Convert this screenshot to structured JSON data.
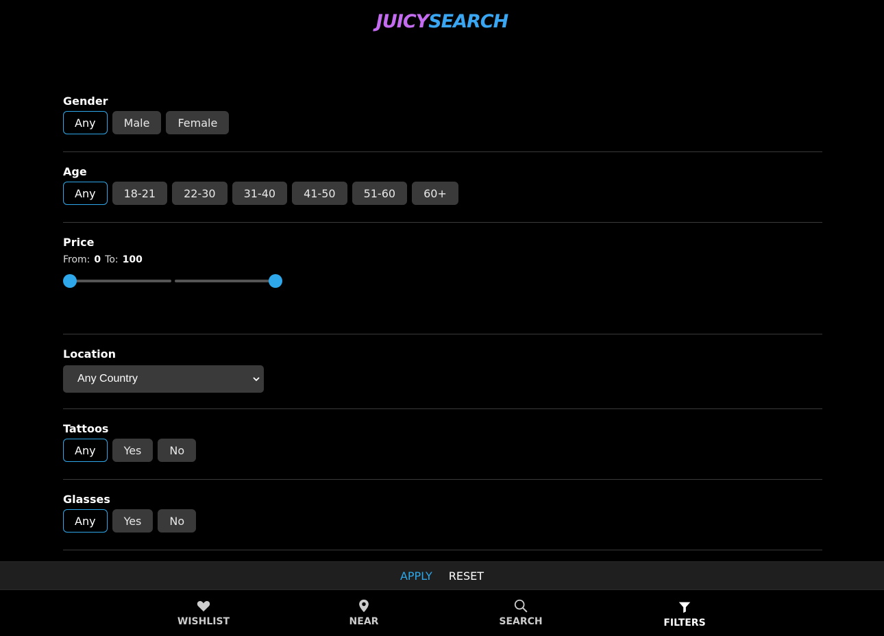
{
  "header": {
    "logo_part1": "JUICY",
    "logo_part2": "SEARCH"
  },
  "filters": {
    "gender": {
      "title": "Gender",
      "options": [
        "Any",
        "Male",
        "Female"
      ],
      "selected": "Any"
    },
    "age": {
      "title": "Age",
      "options": [
        "Any",
        "18-21",
        "22-30",
        "31-40",
        "41-50",
        "51-60",
        "60+"
      ],
      "selected": "Any"
    },
    "price": {
      "title": "Price",
      "from_label": "From:",
      "from_value": "0",
      "to_label": "To:",
      "to_value": "100"
    },
    "location": {
      "title": "Location",
      "selected": "Any Country"
    },
    "tattoos": {
      "title": "Tattoos",
      "options": [
        "Any",
        "Yes",
        "No"
      ],
      "selected": "Any"
    },
    "glasses": {
      "title": "Glasses",
      "options": [
        "Any",
        "Yes",
        "No"
      ],
      "selected": "Any"
    }
  },
  "actions": {
    "apply": "APPLY",
    "reset": "RESET"
  },
  "nav": {
    "wishlist": "WISHLIST",
    "near": "NEAR",
    "search": "SEARCH",
    "filters": "FILTERS",
    "active": "filters"
  },
  "colors": {
    "accent": "#2ea8ea",
    "logo_purple": "#c46cf0",
    "logo_blue": "#3aa5f0",
    "chip_bg": "#3a3a3a"
  }
}
